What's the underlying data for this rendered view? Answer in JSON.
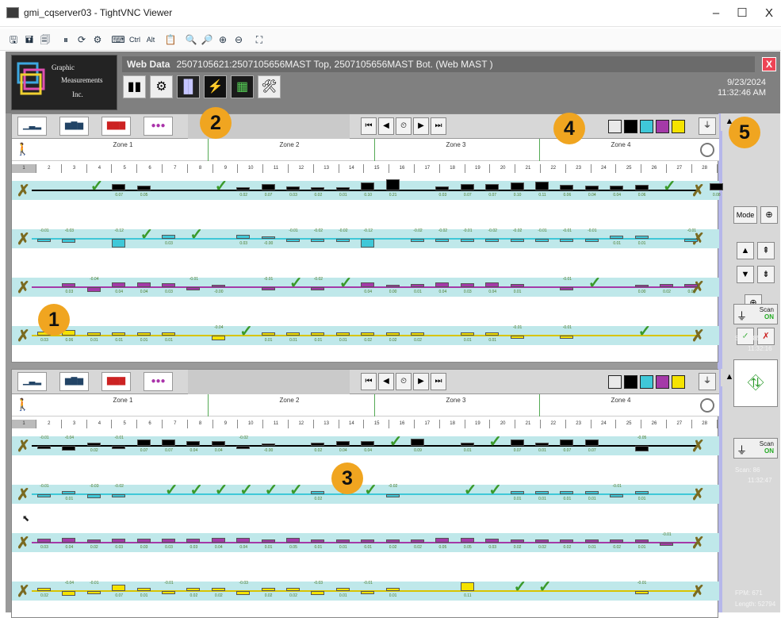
{
  "window": {
    "title": "gmi_cqserver03 - TightVNC Viewer",
    "min": "–",
    "max": "☐",
    "close": "X"
  },
  "toolbar_icons": [
    "toolbar-save-icon",
    "toolbar-print-icon",
    "toolbar-copy-icon",
    "toolbar-pause-icon",
    "toolbar-refresh-icon",
    "toolbar-options-icon",
    "toolbar-keyboard-icon",
    "Ctrl",
    "Alt",
    "toolbar-paste-icon",
    "zoom-in-icon",
    "zoom-out-icon",
    "zoom-fit-icon",
    "zoom-100-icon",
    "fullscreen-icon"
  ],
  "app": {
    "logo": {
      "line1": "Graphic",
      "line2": "Measurements",
      "line3": "Inc."
    },
    "header_title": "Web Data",
    "header_subtitle": "2507105621:2507105656MAST Top, 2507105656MAST Bot. (Web MAST )",
    "date": "9/23/2024",
    "time": "11:32:46 AM",
    "close_label": "X",
    "badges": [
      "1",
      "2",
      "3",
      "4",
      "5"
    ],
    "zones": [
      "Zone 1",
      "Zone 2",
      "Zone 3",
      "Zone 4"
    ],
    "cols": [
      "1",
      "2",
      "3",
      "4",
      "5",
      "6",
      "7",
      "8",
      "9",
      "10",
      "11",
      "12",
      "13",
      "14",
      "15",
      "16",
      "17",
      "18",
      "19",
      "20",
      "21",
      "22",
      "23",
      "24",
      "25",
      "26",
      "27",
      "28"
    ],
    "nav": [
      "⏮",
      "◀",
      "⏲",
      "▶",
      "⏭"
    ],
    "swatches": [
      "#e9e9e9",
      "#000000",
      "#3fc8d8",
      "#a43aa8",
      "#f5e300"
    ],
    "top_panel": {
      "tracks": [
        {
          "color": "#000000",
          "vals": [
            "",
            "",
            "0.08",
            "0.07",
            "0.05",
            "",
            "",
            "",
            "0.02",
            "0.07",
            "0.03",
            "0.02",
            "0.01",
            "0.10",
            "0.21",
            "",
            "0.03",
            "0.07",
            "0.07",
            "0.10",
            "0.11",
            "0.06",
            "0.04",
            "0.04",
            "0.06",
            "",
            "",
            "0.08"
          ],
          "checks": [
            2,
            7,
            25
          ]
        },
        {
          "color": "#3fc8d8",
          "vals": [
            "-0.01",
            "-0.03",
            "",
            "-0.12",
            "",
            "0.03",
            "0.04",
            "",
            "0.03",
            "-0.00",
            "-0.01",
            "-0.02",
            "-0.02",
            "-0.12",
            "",
            "-0.02",
            "-0.02",
            "-0.01",
            "-0.02",
            "-0.02",
            "-0.01",
            "-0.01",
            "-0.01",
            "0.01",
            "0.01",
            "",
            "-0.01"
          ],
          "checks": [
            4,
            6
          ]
        },
        {
          "color": "#a43aa8",
          "vals": [
            "",
            "0.03",
            "-0.04",
            "0.04",
            "0.04",
            "0.03",
            "-0.01",
            "-0.00",
            "",
            "-0.01",
            "",
            "-0.02",
            "-0.03",
            "0.04",
            "0.00",
            "0.01",
            "0.04",
            "0.03",
            "0.04",
            "0.01",
            "",
            "-0.01",
            "0.04",
            "",
            "0.00",
            "0.02",
            "0.01"
          ],
          "checks": [
            10,
            12,
            22
          ]
        },
        {
          "color": "#f5e300",
          "vals": [
            "0.03",
            "0.06",
            "0.01",
            "0.01",
            "0.01",
            "0.01",
            "",
            "-0.04",
            "-0.01",
            "0.01",
            "0.01",
            "0.01",
            "0.01",
            "0.02",
            "0.02",
            "0.02",
            "",
            "0.01",
            "0.01",
            "-0.01",
            "",
            "-0.01",
            "",
            "",
            "0.02"
          ],
          "checks": [
            8,
            24,
            26
          ]
        }
      ]
    },
    "bottom_panel": {
      "tracks": [
        {
          "color": "#000000",
          "vals": [
            "-0.01",
            "-0.04",
            "0.02",
            "-0.01",
            "0.07",
            "0.07",
            "0.04",
            "0.04",
            "-0.02",
            "-0.00",
            "",
            "0.02",
            "0.04",
            "0.04",
            "",
            "0.09",
            "",
            "0.01",
            "0.00",
            "0.07",
            "0.01",
            "0.07",
            "0.07",
            "",
            "-0.05"
          ],
          "checks": [
            14,
            18
          ]
        },
        {
          "color": "#3fc8d8",
          "vals": [
            "-0.01",
            "0.01",
            "-0.03",
            "-0.02",
            "",
            "",
            "",
            "",
            "-0.03",
            "",
            "",
            "0.02",
            "-0.02",
            "-0.02",
            "-0.02",
            "",
            "",
            "0.01",
            "0.04",
            "0.01",
            "0.01",
            "0.01",
            "0.01",
            "-0.01",
            "0.01"
          ],
          "checks": [
            5,
            6,
            7,
            8,
            9,
            10,
            12,
            13,
            17,
            18
          ]
        },
        {
          "color": "#a43aa8",
          "vals": [
            "0.03",
            "0.04",
            "0.02",
            "0.03",
            "0.03",
            "0.03",
            "0.03",
            "0.04",
            "0.04",
            "0.01",
            "0.05",
            "0.01",
            "0.01",
            "0.01",
            "0.02",
            "0.02",
            "0.05",
            "0.05",
            "0.03",
            "0.02",
            "0.02",
            "0.02",
            "0.01",
            "0.02",
            "0.01",
            "-0.01"
          ],
          "checks": []
        },
        {
          "color": "#f5e300",
          "vals": [
            "0.02",
            "-0.04",
            "-0.01",
            "0.07",
            "0.01",
            "-0.01",
            "0.02",
            "0.02",
            "-0.03",
            "0.02",
            "0.02",
            "-0.03",
            "0.01",
            "-0.01",
            "0.01",
            "",
            "",
            "0.11",
            "",
            "-0.01",
            "",
            "",
            "",
            "",
            "-0.01"
          ],
          "checks": [
            19,
            20,
            25
          ]
        }
      ]
    },
    "side": {
      "mode": "Mode",
      "scan_label": "Scan",
      "scan_state": "ON",
      "top_scan": "Scan: 85",
      "top_time": "11:32:16",
      "bot_scan": "Scan: 86",
      "bot_time": "11:32:47",
      "fpm": "FPM: 671",
      "length": "Length: 52794"
    }
  }
}
